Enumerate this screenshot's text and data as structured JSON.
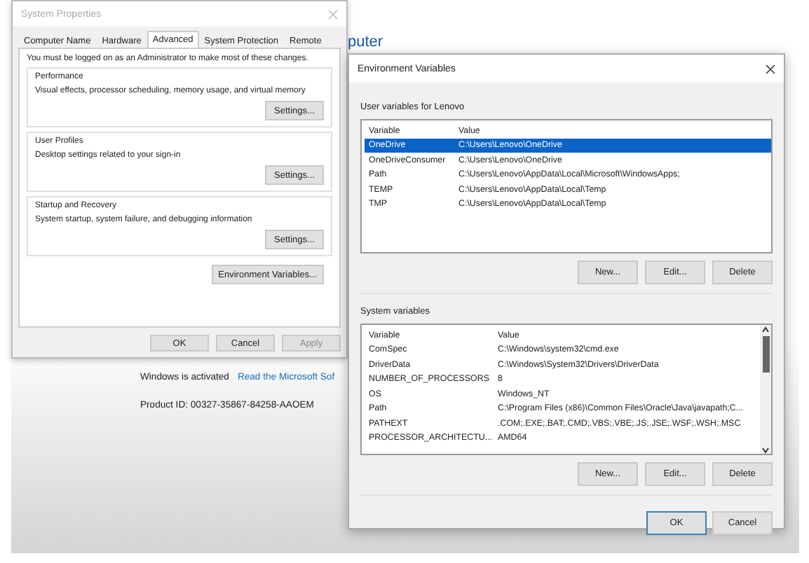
{
  "background_window": {
    "heading": "puter",
    "activation_status": "Windows is activated",
    "activation_link": "Read the Microsoft Sof",
    "product_id": "Product ID: 00327-35867-84258-AAOEM"
  },
  "system_properties": {
    "title": "System Properties",
    "tabs": [
      {
        "label": "Computer Name",
        "selected": false
      },
      {
        "label": "Hardware",
        "selected": false
      },
      {
        "label": "Advanced",
        "selected": true
      },
      {
        "label": "System Protection",
        "selected": false
      },
      {
        "label": "Remote",
        "selected": false
      }
    ],
    "notice": "You must be logged on as an Administrator to make most of these changes.",
    "groups": [
      {
        "title": "Performance",
        "description": "Visual effects, processor scheduling, memory usage, and virtual memory",
        "button": "Settings..."
      },
      {
        "title": "User Profiles",
        "description": "Desktop settings related to your sign-in",
        "button": "Settings..."
      },
      {
        "title": "Startup and Recovery",
        "description": "System startup, system failure, and debugging information",
        "button": "Settings..."
      }
    ],
    "env_button": "Environment Variables...",
    "buttons": [
      {
        "label": "OK",
        "disabled": false
      },
      {
        "label": "Cancel",
        "disabled": false
      },
      {
        "label": "Apply",
        "disabled": true
      }
    ]
  },
  "environment_variables": {
    "title": "Environment Variables",
    "user_section": {
      "label": "User variables for Lenovo",
      "columns": [
        "Variable",
        "Value"
      ],
      "rows": [
        {
          "variable": "OneDrive",
          "value": "C:\\Users\\Lenovo\\OneDrive",
          "selected": true
        },
        {
          "variable": "OneDriveConsumer",
          "value": "C:\\Users\\Lenovo\\OneDrive",
          "selected": false
        },
        {
          "variable": "Path",
          "value": "C:\\Users\\Lenovo\\AppData\\Local\\Microsoft\\WindowsApps;",
          "selected": false
        },
        {
          "variable": "TEMP",
          "value": "C:\\Users\\Lenovo\\AppData\\Local\\Temp",
          "selected": false
        },
        {
          "variable": "TMP",
          "value": "C:\\Users\\Lenovo\\AppData\\Local\\Temp",
          "selected": false
        }
      ],
      "buttons": [
        "New...",
        "Edit...",
        "Delete"
      ]
    },
    "system_section": {
      "label": "System variables",
      "columns": [
        "Variable",
        "Value"
      ],
      "rows": [
        {
          "variable": "ComSpec",
          "value": "C:\\Windows\\system32\\cmd.exe",
          "selected": false
        },
        {
          "variable": "DriverData",
          "value": "C:\\Windows\\System32\\Drivers\\DriverData",
          "selected": false
        },
        {
          "variable": "NUMBER_OF_PROCESSORS",
          "value": "8",
          "selected": false
        },
        {
          "variable": "OS",
          "value": "Windows_NT",
          "selected": false
        },
        {
          "variable": "Path",
          "value": "C:\\Program Files (x86)\\Common Files\\Oracle\\Java\\javapath;C...",
          "selected": false
        },
        {
          "variable": "PATHEXT",
          "value": ".COM;.EXE;.BAT;.CMD;.VBS;.VBE;.JS;.JSE;.WSF;.WSH;.MSC",
          "selected": false
        },
        {
          "variable": "PROCESSOR_ARCHITECTU...",
          "value": "AMD64",
          "selected": false
        }
      ],
      "buttons": [
        "New...",
        "Edit...",
        "Delete"
      ]
    },
    "footer_buttons": [
      {
        "label": "OK",
        "default": true
      },
      {
        "label": "Cancel",
        "default": false
      }
    ]
  }
}
